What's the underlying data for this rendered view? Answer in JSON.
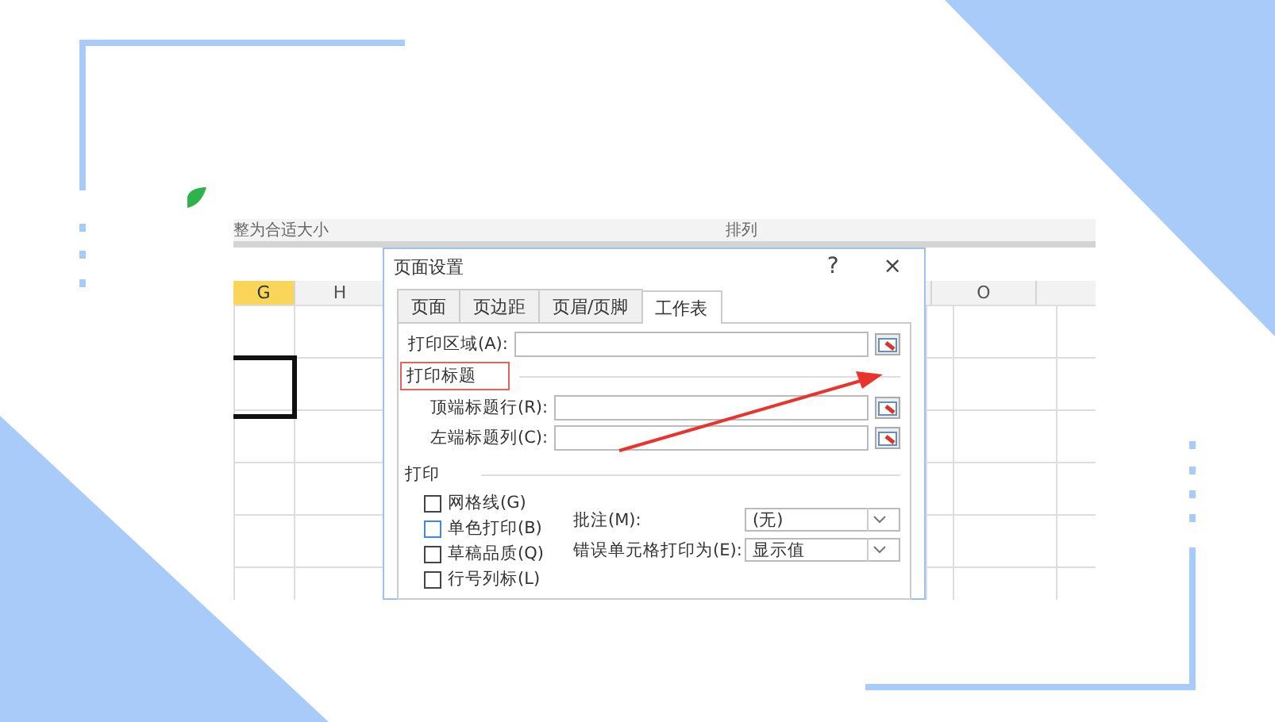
{
  "ribbon": {
    "groups": [
      "整为合适大小",
      "排列"
    ]
  },
  "sheet": {
    "columns": [
      {
        "label": "G",
        "selected": true
      },
      {
        "label": "H",
        "selected": false
      },
      {
        "label": "O",
        "selected": false
      }
    ]
  },
  "dialog": {
    "title": "页面设置",
    "help": "?",
    "close": "×",
    "tabs": [
      {
        "label": "页面",
        "selected": false
      },
      {
        "label": "页边距",
        "selected": false
      },
      {
        "label": "页眉/页脚",
        "selected": false
      },
      {
        "label": "工作表",
        "selected": true
      }
    ],
    "print_area": {
      "label": "打印区域(A):"
    },
    "print_titles": {
      "heading": "打印标题",
      "highlighted": true,
      "rows_label": "顶端标题行(R):",
      "cols_label": "左端标题列(C):"
    },
    "print": {
      "heading": "打印",
      "options": [
        {
          "label": "网格线(G)",
          "checked": false,
          "focused": false
        },
        {
          "label": "单色打印(B)",
          "checked": false,
          "focused": true
        },
        {
          "label": "草稿品质(Q)",
          "checked": false,
          "focused": false
        },
        {
          "label": "行号列标(L)",
          "checked": false,
          "focused": false
        }
      ],
      "comments": {
        "label": "批注(M):",
        "value": "(无)"
      },
      "errors": {
        "label": "错误单元格打印为(E):",
        "value": "显示值"
      }
    }
  }
}
